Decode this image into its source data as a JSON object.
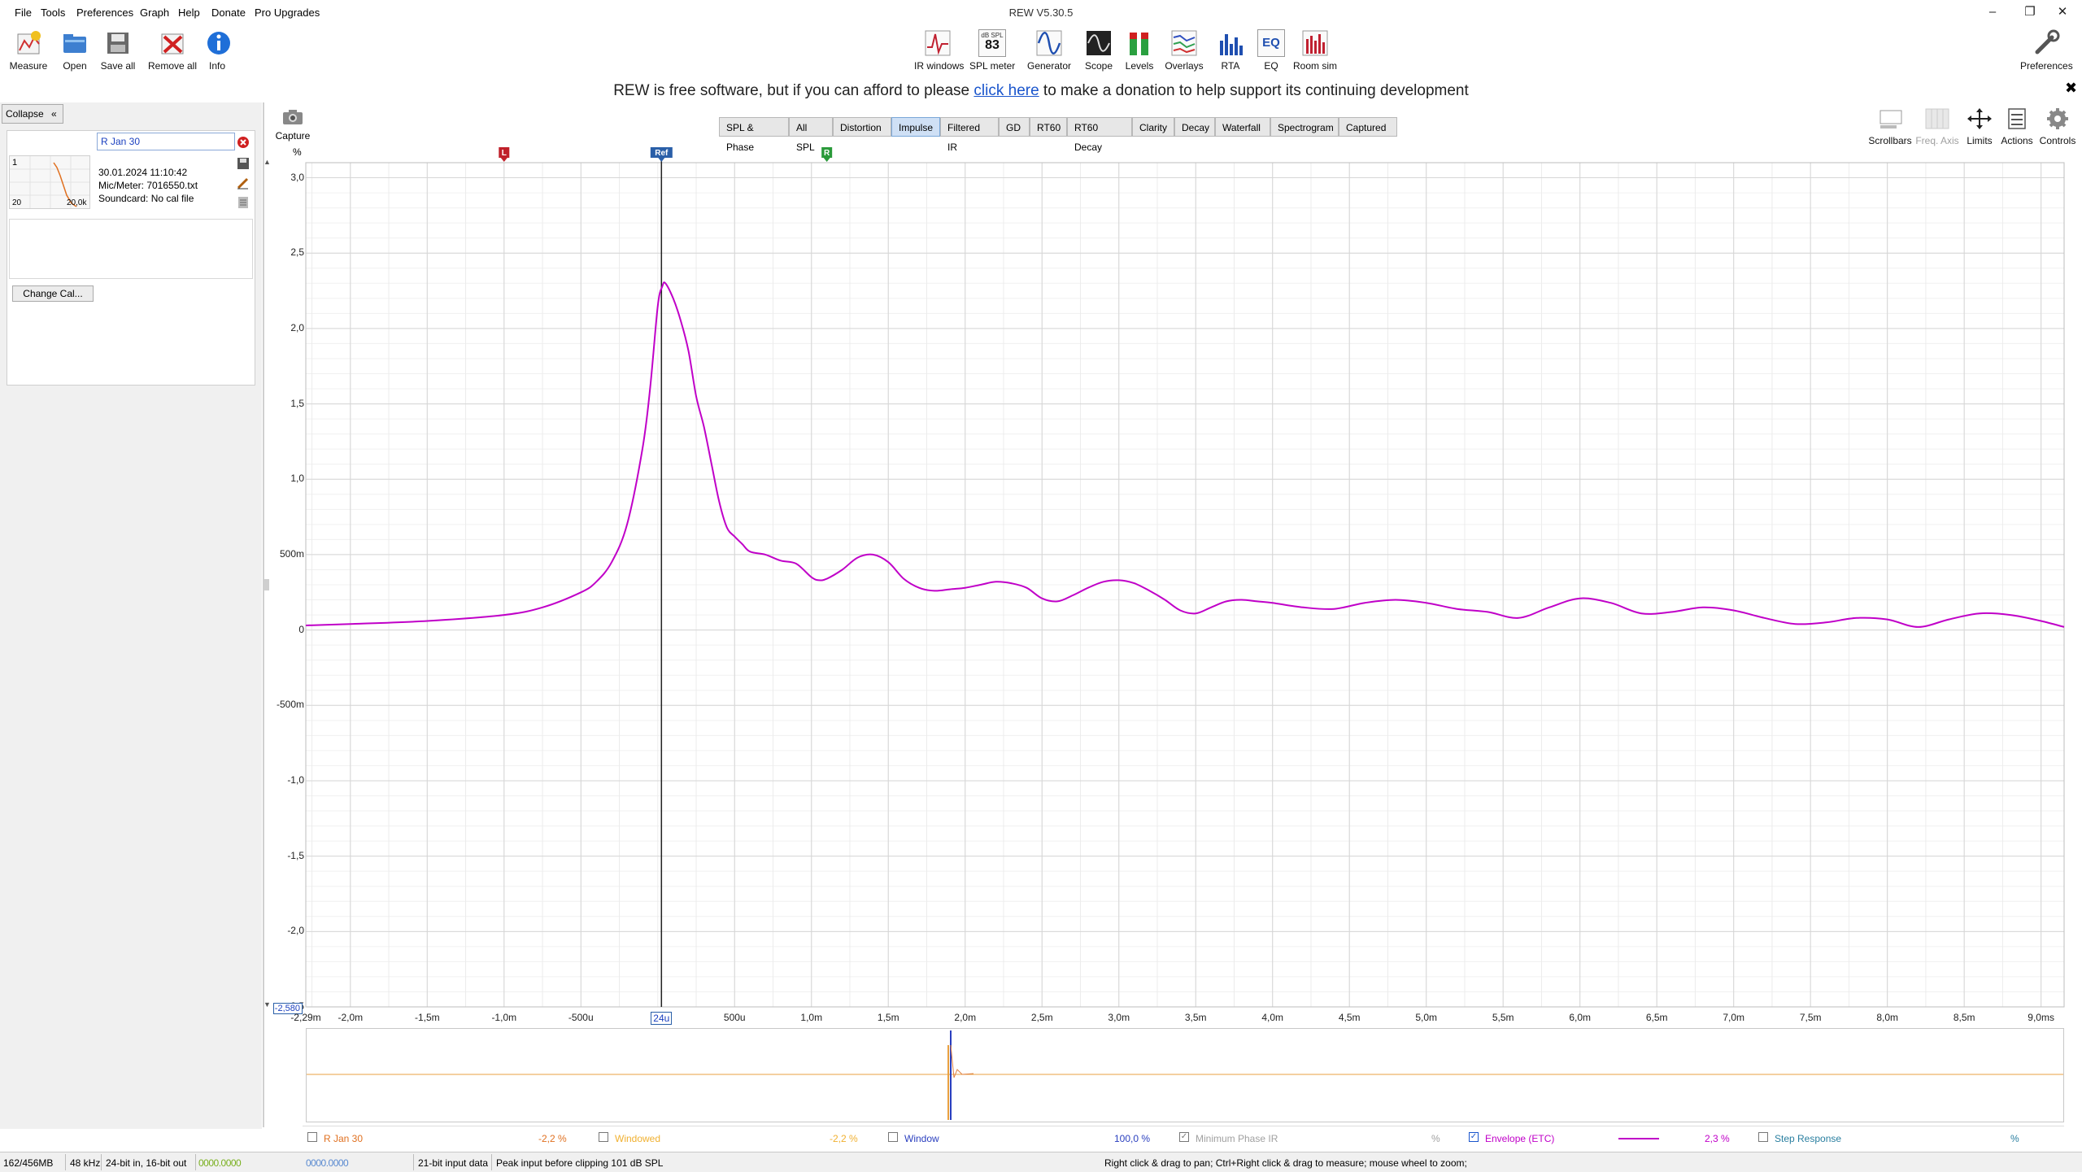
{
  "window": {
    "title": "REW V5.30.5"
  },
  "menu": [
    "File",
    "Tools",
    "Preferences",
    "Graph",
    "Help",
    "Donate",
    "Pro Upgrades"
  ],
  "toolbar_left": [
    {
      "label": "Measure",
      "icon": "measure-icon"
    },
    {
      "label": "Open",
      "icon": "folder-icon"
    },
    {
      "label": "Save all",
      "icon": "save-icon"
    },
    {
      "label": "Remove all",
      "icon": "remove-icon"
    },
    {
      "label": "Info",
      "icon": "info-icon"
    }
  ],
  "toolbar_center": [
    {
      "label": "IR windows",
      "icon": "ir-windows-icon"
    },
    {
      "label": "SPL meter",
      "icon": "spl-meter-icon",
      "badge_top": "dB SPL",
      "badge_value": "83"
    },
    {
      "label": "Generator",
      "icon": "generator-icon"
    },
    {
      "label": "Scope",
      "icon": "scope-icon"
    },
    {
      "label": "Levels",
      "icon": "levels-icon"
    },
    {
      "label": "Overlays",
      "icon": "overlays-icon"
    },
    {
      "label": "RTA",
      "icon": "rta-icon"
    },
    {
      "label": "EQ",
      "icon": "eq-icon",
      "badge_value": "EQ"
    },
    {
      "label": "Room sim",
      "icon": "room-sim-icon"
    }
  ],
  "toolbar_right": {
    "label": "Preferences",
    "icon": "wrench-icon"
  },
  "donation": {
    "before": "REW is free software, but if you can afford to please ",
    "link": "click here",
    "after": " to make a donation to help support its continuing development"
  },
  "sidebar": {
    "collapse_label": "Collapse",
    "measurement_name": "R Jan 30",
    "measurement_index": "1",
    "thumb_left_label": "20",
    "thumb_right_label": "20,0k",
    "date": "30.01.2024 11:10:42",
    "mic": "Mic/Meter: 7016550.txt",
    "soundcard": "Soundcard: No cal file",
    "change_cal": "Change Cal..."
  },
  "capture": {
    "label": "Capture"
  },
  "graph_tabs": [
    "SPL & Phase",
    "All SPL",
    "Distortion",
    "Impulse",
    "Filtered IR",
    "GD",
    "RT60",
    "RT60 Decay",
    "Clarity",
    "Decay",
    "Waterfall",
    "Spectrogram",
    "Captured"
  ],
  "selected_tab": "Impulse",
  "right_tools": [
    {
      "label": "Scrollbars",
      "disabled": false
    },
    {
      "label": "Freq. Axis",
      "disabled": true
    },
    {
      "label": "Limits",
      "disabled": false
    },
    {
      "label": "Actions",
      "disabled": false
    },
    {
      "label": "Controls",
      "disabled": false
    }
  ],
  "chart_data": {
    "type": "line",
    "ylabel": "%",
    "xlim": [
      -2.29,
      9.15
    ],
    "ylim": [
      -2.5,
      3.1
    ],
    "x_unit": "ms",
    "y_ticks": [
      {
        "v": 3.0,
        "label": "3,0"
      },
      {
        "v": 2.5,
        "label": "2,5"
      },
      {
        "v": 2.0,
        "label": "2,0"
      },
      {
        "v": 1.5,
        "label": "1,5"
      },
      {
        "v": 1.0,
        "label": "1,0"
      },
      {
        "v": 0.5,
        "label": "500m"
      },
      {
        "v": 0.0,
        "label": "0"
      },
      {
        "v": -0.5,
        "label": "-500m"
      },
      {
        "v": -1.0,
        "label": "-1,0"
      },
      {
        "v": -1.5,
        "label": "-1,5"
      },
      {
        "v": -2.0,
        "label": "-2,0"
      },
      {
        "v": -2.5,
        "label": "-2,5"
      }
    ],
    "y_readout": "-2,580",
    "x_ticks": [
      {
        "v": -2.29,
        "label": "-2,29m"
      },
      {
        "v": -2.0,
        "label": "-2,0m"
      },
      {
        "v": -1.5,
        "label": "-1,5m"
      },
      {
        "v": -1.0,
        "label": "-1,0m"
      },
      {
        "v": -0.5,
        "label": "-500u"
      },
      {
        "v": 0.024,
        "label": "24u"
      },
      {
        "v": 0.5,
        "label": "500u"
      },
      {
        "v": 1.0,
        "label": "1,0m"
      },
      {
        "v": 1.5,
        "label": "1,5m"
      },
      {
        "v": 2.0,
        "label": "2,0m"
      },
      {
        "v": 2.5,
        "label": "2,5m"
      },
      {
        "v": 3.0,
        "label": "3,0m"
      },
      {
        "v": 3.5,
        "label": "3,5m"
      },
      {
        "v": 4.0,
        "label": "4,0m"
      },
      {
        "v": 4.5,
        "label": "4,5m"
      },
      {
        "v": 5.0,
        "label": "5,0m"
      },
      {
        "v": 5.5,
        "label": "5,5m"
      },
      {
        "v": 6.0,
        "label": "6,0m"
      },
      {
        "v": 6.5,
        "label": "6,5m"
      },
      {
        "v": 7.0,
        "label": "7,0m"
      },
      {
        "v": 7.5,
        "label": "7,5m"
      },
      {
        "v": 8.0,
        "label": "8,0m"
      },
      {
        "v": 8.5,
        "label": "8,5m"
      },
      {
        "v": 9.0,
        "label": "9,0ms"
      }
    ],
    "markers": [
      {
        "label": "L",
        "x": -1.0,
        "color": "#c0202a"
      },
      {
        "label": "Ref",
        "x": 0.024,
        "color": "#2a5fa8"
      },
      {
        "label": "R",
        "x": 1.1,
        "color": "#2a9a3a"
      }
    ],
    "grid": true,
    "series": [
      {
        "name": "Envelope (ETC)",
        "color": "#c000c8",
        "x": [
          -2.29,
          -2.0,
          -1.5,
          -1.0,
          -0.75,
          -0.5,
          -0.4,
          -0.3,
          -0.2,
          -0.1,
          -0.05,
          0.0,
          0.03,
          0.05,
          0.1,
          0.15,
          0.2,
          0.25,
          0.3,
          0.35,
          0.4,
          0.45,
          0.5,
          0.55,
          0.6,
          0.7,
          0.8,
          0.9,
          1.0,
          1.05,
          1.1,
          1.2,
          1.3,
          1.4,
          1.5,
          1.6,
          1.7,
          1.8,
          1.9,
          2.0,
          2.1,
          2.2,
          2.3,
          2.4,
          2.5,
          2.6,
          2.7,
          2.8,
          2.9,
          3.0,
          3.1,
          3.2,
          3.3,
          3.4,
          3.5,
          3.6,
          3.7,
          3.8,
          3.9,
          4.0,
          4.2,
          4.4,
          4.6,
          4.8,
          5.0,
          5.2,
          5.4,
          5.6,
          5.8,
          6.0,
          6.2,
          6.4,
          6.6,
          6.8,
          7.0,
          7.2,
          7.4,
          7.6,
          7.8,
          8.0,
          8.2,
          8.4,
          8.6,
          8.8,
          9.0,
          9.15
        ],
        "y": [
          0.03,
          0.04,
          0.06,
          0.1,
          0.15,
          0.25,
          0.32,
          0.45,
          0.7,
          1.2,
          1.6,
          2.15,
          2.28,
          2.3,
          2.2,
          2.05,
          1.85,
          1.55,
          1.35,
          1.1,
          0.85,
          0.68,
          0.62,
          0.57,
          0.52,
          0.5,
          0.46,
          0.44,
          0.35,
          0.33,
          0.34,
          0.4,
          0.48,
          0.5,
          0.45,
          0.34,
          0.28,
          0.26,
          0.27,
          0.28,
          0.3,
          0.32,
          0.31,
          0.28,
          0.21,
          0.19,
          0.23,
          0.28,
          0.32,
          0.33,
          0.31,
          0.26,
          0.2,
          0.13,
          0.11,
          0.15,
          0.19,
          0.2,
          0.19,
          0.18,
          0.15,
          0.14,
          0.18,
          0.2,
          0.18,
          0.14,
          0.12,
          0.08,
          0.15,
          0.21,
          0.18,
          0.11,
          0.12,
          0.15,
          0.13,
          0.08,
          0.04,
          0.05,
          0.08,
          0.07,
          0.02,
          0.07,
          0.11,
          0.1,
          0.06,
          0.02
        ]
      }
    ]
  },
  "overview": {
    "color_ir": "#2a3fbf",
    "color_window": "#e8a040"
  },
  "legend": [
    {
      "name": "R Jan 30",
      "value": "-2,2 %",
      "checked": false,
      "color": "#e07020"
    },
    {
      "name": "Windowed",
      "value": "-2,2 %",
      "checked": false,
      "color": "#f0b030"
    },
    {
      "name": "Window",
      "value": "100,0 %",
      "checked": false,
      "color": "#2a3fbf"
    },
    {
      "name": "Minimum Phase IR",
      "value": "%",
      "checked": true,
      "color": "#a0a0a0"
    },
    {
      "name": "Envelope (ETC)",
      "value": "2,3 %",
      "checked": true,
      "color": "#c000c8"
    },
    {
      "name": "Step Response",
      "value": "%",
      "checked": false,
      "color": "#2a7fa0"
    }
  ],
  "status": {
    "memory": "162/456MB",
    "rate": "48 kHz",
    "bits": "24-bit in, 16-bit out",
    "meter_left": "0000.0000",
    "meter_right": "0000.0000",
    "input_bits": "21-bit input data",
    "peak": "Peak input before clipping 101 dB SPL",
    "hint": "Right click & drag to pan; Ctrl+Right click & drag to measure; mouse wheel to zoom;"
  }
}
